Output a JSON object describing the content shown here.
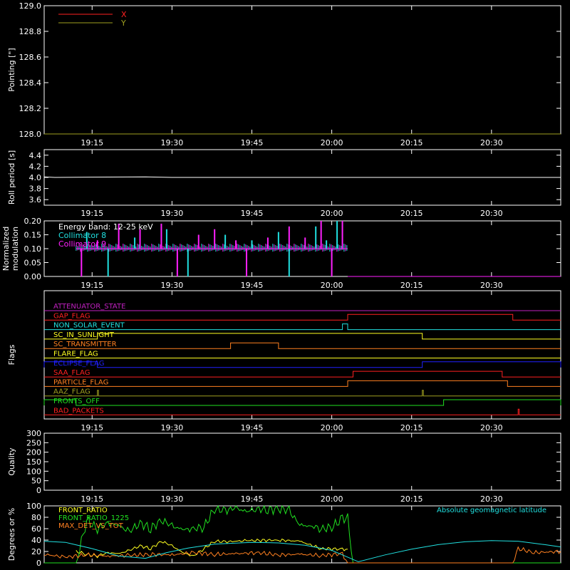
{
  "colors": {
    "background": "#000000",
    "axis": "#ffffff",
    "red": "#ff2020",
    "olive": "#a0a020",
    "white": "#ffffff",
    "cyan": "#20e0e0",
    "magenta": "#ff20ff",
    "green": "#20e020",
    "orange": "#ff8020",
    "yellow": "#ffff20",
    "blue": "#2020ff",
    "purple": "#c020c0"
  },
  "time_ticks": [
    "19:15",
    "19:30",
    "19:45",
    "20:00",
    "20:15",
    "20:30"
  ],
  "chart_data": [
    {
      "type": "line",
      "ylabel": "Pointing [\"]",
      "ylim": [
        128.0,
        129.0
      ],
      "y_ticks": [
        "128.0",
        "128.2",
        "128.4",
        "128.6",
        "128.8",
        "129.0"
      ],
      "legend": [
        {
          "name": "X",
          "color": "#ff2020"
        },
        {
          "name": "Y",
          "color": "#a0a020"
        }
      ],
      "series": [
        {
          "name": "Y",
          "color": "#a0a020",
          "x": [
            "19:06",
            "20:43"
          ],
          "values": [
            128.0,
            128.0
          ]
        }
      ]
    },
    {
      "type": "line",
      "ylabel": "Roll period [s]",
      "ylim": [
        3.5,
        4.5
      ],
      "y_ticks": [
        "3.6",
        "3.8",
        "4.0",
        "4.2",
        "4.4"
      ],
      "series": [
        {
          "name": "",
          "color": "#ffffff",
          "x": [
            "19:06",
            "19:08",
            "19:25",
            "19:30",
            "20:43"
          ],
          "values": [
            4.01,
            4.0,
            4.01,
            4.0,
            4.0
          ]
        }
      ]
    },
    {
      "type": "bar",
      "ylabel": "Normalized modulation",
      "ylim": [
        0.0,
        0.2
      ],
      "y_ticks": [
        "0.00",
        "0.05",
        "0.10",
        "0.15",
        "0.20"
      ],
      "annotation": "Energy band: 12-25 keV",
      "legend": [
        {
          "name": "Collimator 8",
          "color": "#20e0e0"
        },
        {
          "name": "Collimator 9",
          "color": "#ff20ff"
        }
      ],
      "data_range": [
        "19:12",
        "20:03"
      ],
      "baseline": 0.1,
      "series": [
        {
          "name": "Collimator 8",
          "color": "#20e0e0",
          "spikes": [
            [
              "19:14",
              0.16
            ],
            [
              "19:18",
              0.0
            ],
            [
              "19:23",
              0.14
            ],
            [
              "19:29",
              0.17
            ],
            [
              "19:33",
              0.0
            ],
            [
              "19:40",
              0.15
            ],
            [
              "19:45",
              0.13
            ],
            [
              "19:50",
              0.16
            ],
            [
              "19:52",
              0.0
            ],
            [
              "19:57",
              0.18
            ],
            [
              "19:59",
              0.13
            ],
            [
              "20:01",
              0.2
            ]
          ]
        },
        {
          "name": "Collimator 9",
          "color": "#ff20ff",
          "spikes": [
            [
              "19:13",
              0.0
            ],
            [
              "19:16",
              0.13
            ],
            [
              "19:20",
              0.19
            ],
            [
              "19:24",
              0.17
            ],
            [
              "19:28",
              0.19
            ],
            [
              "19:31",
              0.0
            ],
            [
              "19:35",
              0.15
            ],
            [
              "19:38",
              0.17
            ],
            [
              "19:42",
              0.13
            ],
            [
              "19:44",
              0.0
            ],
            [
              "19:48",
              0.14
            ],
            [
              "19:52",
              0.18
            ],
            [
              "19:55",
              0.14
            ],
            [
              "19:58",
              0.2
            ],
            [
              "20:00",
              0.0
            ],
            [
              "20:02",
              0.2
            ]
          ]
        }
      ]
    },
    {
      "type": "step",
      "ylabel": "Flags",
      "flags": [
        {
          "name": "ATTENUATOR_STATE",
          "color": "#c020c0",
          "high": []
        },
        {
          "name": "GAP_FLAG",
          "color": "#ff2020",
          "high": [
            [
              "20:03",
              "20:34"
            ]
          ]
        },
        {
          "name": "NON_SOLAR_EVENT",
          "color": "#20e0e0",
          "high": [
            [
              "20:02",
              "20:03"
            ]
          ]
        },
        {
          "name": "SC_IN_SUNLIGHT",
          "color": "#ffff20",
          "high": [
            [
              "19:16",
              "20:17"
            ]
          ]
        },
        {
          "name": "SC_TRANSMITTER",
          "color": "#ff8020",
          "high": [
            [
              "19:41",
              "19:50"
            ]
          ]
        },
        {
          "name": "FLARE_FLAG",
          "color": "#ffff20",
          "high": []
        },
        {
          "name": "ECLIPSE_FLAG",
          "color": "#2020ff",
          "high": [
            [
              "19:06",
              "19:16"
            ],
            [
              "20:17",
              "20:43"
            ]
          ]
        },
        {
          "name": "SAA_FLAG",
          "color": "#ff2020",
          "high": [
            [
              "20:04",
              "20:32"
            ]
          ]
        },
        {
          "name": "PARTICLE_FLAG",
          "color": "#ff8020",
          "high": [
            [
              "20:03",
              "20:33"
            ]
          ]
        },
        {
          "name": "AAZ_FLAG",
          "color": "#a0a020",
          "high": [
            [
              "19:16",
              "19:16"
            ],
            [
              "20:17",
              "20:17"
            ]
          ]
        },
        {
          "name": "FRONTS_OFF",
          "color": "#20e020",
          "high": [
            [
              "19:06",
              "19:12"
            ],
            [
              "20:21",
              "20:43"
            ]
          ]
        },
        {
          "name": "BAD_PACKETS",
          "color": "#ff2020",
          "high": [
            [
              "20:35",
              "20:35"
            ]
          ]
        }
      ]
    },
    {
      "type": "line",
      "ylabel": "Quality",
      "ylim": [
        0,
        300
      ],
      "y_ticks": [
        "0",
        "50",
        "100",
        "150",
        "200",
        "250",
        "300"
      ],
      "series": []
    },
    {
      "type": "line",
      "ylabel": "Degrees or %",
      "ylim": [
        0,
        100
      ],
      "y_ticks": [
        "0",
        "20",
        "40",
        "60",
        "80",
        "100"
      ],
      "legend_right": {
        "name": "Absolute geomagnetic latitude",
        "color": "#20e0e0"
      },
      "series": [
        {
          "name": "FRONT_RATIO",
          "color": "#ffff20",
          "x": [
            "19:12",
            "19:14",
            "19:16",
            "19:18",
            "19:20",
            "19:22",
            "19:24",
            "19:26",
            "19:28",
            "19:30",
            "19:32",
            "19:34",
            "19:36",
            "19:38",
            "19:40",
            "19:44",
            "19:50",
            "19:54",
            "19:58",
            "20:02",
            "20:03"
          ],
          "values": [
            20,
            15,
            12,
            18,
            16,
            22,
            30,
            25,
            38,
            30,
            18,
            12,
            25,
            38,
            37,
            39,
            40,
            38,
            25,
            24,
            24
          ]
        },
        {
          "name": "FRONT_RATIO_1225",
          "color": "#20e020",
          "x": [
            "19:06",
            "19:12",
            "19:14",
            "19:16",
            "19:18",
            "19:20",
            "19:22",
            "19:24",
            "19:26",
            "19:28",
            "19:30",
            "19:32",
            "19:34",
            "19:36",
            "19:38",
            "19:40",
            "19:42",
            "19:44",
            "19:46",
            "19:48",
            "19:50",
            "19:52",
            "19:54",
            "19:56",
            "19:58",
            "20:00",
            "20:02",
            "20:03",
            "20:04",
            "20:43"
          ],
          "values": [
            0,
            0,
            75,
            60,
            70,
            65,
            55,
            70,
            60,
            75,
            65,
            58,
            60,
            63,
            95,
            92,
            96,
            90,
            95,
            93,
            95,
            92,
            66,
            65,
            60,
            62,
            78,
            78,
            0,
            0
          ]
        },
        {
          "name": "MAX_DET_VS_TOT",
          "color": "#ff8020",
          "x": [
            "19:06",
            "19:10",
            "19:14",
            "19:18",
            "19:22",
            "19:26",
            "19:30",
            "19:34",
            "19:38",
            "19:42",
            "19:46",
            "19:50",
            "19:54",
            "19:58",
            "20:02",
            "20:03",
            "20:34",
            "20:35",
            "20:38",
            "20:43"
          ],
          "values": [
            15,
            10,
            14,
            12,
            13,
            15,
            14,
            18,
            15,
            16,
            18,
            14,
            15,
            13,
            16,
            0,
            0,
            25,
            18,
            20
          ]
        },
        {
          "name": "Absolute geomagnetic latitude",
          "color": "#20e0e0",
          "x": [
            "19:06",
            "19:10",
            "19:15",
            "19:20",
            "19:25",
            "19:29",
            "19:33",
            "19:38",
            "19:45",
            "19:50",
            "19:55",
            "20:00",
            "20:05",
            "20:10",
            "20:15",
            "20:20",
            "20:25",
            "20:30",
            "20:35",
            "20:40",
            "20:43"
          ],
          "values": [
            38,
            36,
            25,
            12,
            8,
            18,
            26,
            33,
            36,
            35,
            31,
            22,
            2,
            14,
            24,
            32,
            37,
            39,
            38,
            32,
            28
          ]
        }
      ]
    }
  ]
}
